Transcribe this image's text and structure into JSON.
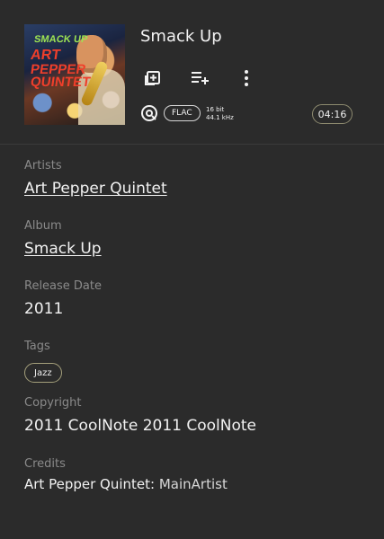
{
  "track": {
    "title": "Smack Up",
    "format": "FLAC",
    "bit_depth": "16 bit",
    "sample_rate": "44.1 kHz",
    "duration": "04:16"
  },
  "cover": {
    "title": "SMACK UP",
    "line1": "ART",
    "line2": "PEPPER",
    "line3": "QUINTET"
  },
  "details": {
    "artists_label": "Artists",
    "artists_value": "Art Pepper Quintet",
    "album_label": "Album",
    "album_value": "Smack Up",
    "release_label": "Release Date",
    "release_value": "2011",
    "tags_label": "Tags",
    "tag": "Jazz",
    "copyright_label": "Copyright",
    "copyright_value": "2011 CoolNote 2011 CoolNote",
    "credits_label": "Credits",
    "credits_artist": "Art Pepper Quintet:",
    "credits_role": "MainArtist"
  },
  "icons": {
    "add_library": "add-to-library-icon",
    "add_queue": "add-to-queue-icon",
    "more": "more-vert-icon",
    "quality": "hi-res-quality-icon"
  },
  "colors": {
    "background": "#2b2b2b",
    "text_primary": "#f2f2f2",
    "text_secondary": "#8a8a8a",
    "badge_border": "#a49f7b"
  }
}
